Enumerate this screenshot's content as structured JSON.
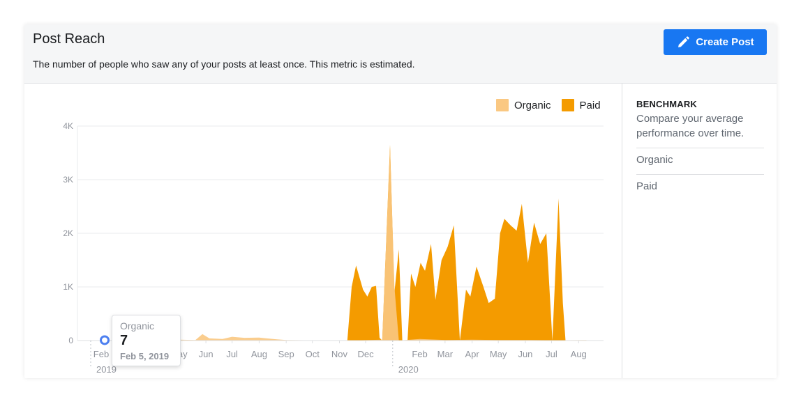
{
  "header": {
    "title": "Post Reach",
    "subtitle": "The number of people who saw any of your posts at least once. This metric is estimated.",
    "create_post_label": "Create Post"
  },
  "colors": {
    "organic": "#fac882",
    "paid": "#f49b00",
    "primary": "#1877f2",
    "highlight": "#4c7ff0"
  },
  "chart_data": {
    "type": "area",
    "title": "",
    "xlabel": "",
    "ylabel": "",
    "ylim": [
      0,
      4000
    ],
    "y_ticks": [
      {
        "value": 0,
        "label": "0"
      },
      {
        "value": 1000,
        "label": "1K"
      },
      {
        "value": 2000,
        "label": "2K"
      },
      {
        "value": 3000,
        "label": "3K"
      },
      {
        "value": 4000,
        "label": "4K"
      }
    ],
    "x_ticks": [
      "Feb",
      "May",
      "Jun",
      "Jul",
      "Aug",
      "Sep",
      "Oct",
      "Nov",
      "Dec",
      "Feb",
      "Mar",
      "Apr",
      "May",
      "Jun",
      "Jul",
      "Aug"
    ],
    "x_years": [
      "2019",
      "2020"
    ],
    "legend_position": "top-right",
    "grid": true,
    "series": [
      {
        "name": "Organic",
        "points": [
          [
            "2019-02-05",
            7
          ],
          [
            "2019-04-01",
            5
          ],
          [
            "2019-05-01",
            15
          ],
          [
            "2019-05-20",
            10
          ],
          [
            "2019-05-28",
            120
          ],
          [
            "2019-06-05",
            40
          ],
          [
            "2019-06-20",
            30
          ],
          [
            "2019-07-01",
            70
          ],
          [
            "2019-07-15",
            50
          ],
          [
            "2019-08-01",
            55
          ],
          [
            "2019-08-20",
            25
          ],
          [
            "2019-09-01",
            10
          ],
          [
            "2019-10-01",
            5
          ],
          [
            "2019-11-01",
            0
          ],
          [
            "2019-11-10",
            0
          ],
          [
            "2019-12-20",
            15
          ],
          [
            "2019-12-29",
            3600
          ],
          [
            "2020-01-03",
            1000
          ],
          [
            "2020-01-08",
            0
          ],
          [
            "2020-02-01",
            30
          ],
          [
            "2020-03-01",
            10
          ],
          [
            "2020-04-01",
            15
          ],
          [
            "2020-05-01",
            10
          ],
          [
            "2020-06-01",
            10
          ],
          [
            "2020-07-01",
            5
          ],
          [
            "2020-08-10",
            10
          ]
        ]
      },
      {
        "name": "Paid",
        "points": [
          [
            "2019-02-05",
            0
          ],
          [
            "2019-11-10",
            0
          ],
          [
            "2019-11-15",
            1000
          ],
          [
            "2019-11-20",
            1400
          ],
          [
            "2019-11-28",
            950
          ],
          [
            "2019-12-03",
            820
          ],
          [
            "2019-12-08",
            1000
          ],
          [
            "2019-12-13",
            1020
          ],
          [
            "2019-12-17",
            50
          ],
          [
            "2019-12-20",
            0
          ],
          [
            "2019-12-29",
            3650
          ],
          [
            "2020-01-03",
            900
          ],
          [
            "2020-01-08",
            1700
          ],
          [
            "2020-01-12",
            0
          ],
          [
            "2020-01-18",
            0
          ],
          [
            "2020-01-22",
            1250
          ],
          [
            "2020-01-27",
            1000
          ],
          [
            "2020-02-02",
            1450
          ],
          [
            "2020-02-07",
            1300
          ],
          [
            "2020-02-14",
            1800
          ],
          [
            "2020-02-19",
            760
          ],
          [
            "2020-02-26",
            1500
          ],
          [
            "2020-03-04",
            1750
          ],
          [
            "2020-03-11",
            2150
          ],
          [
            "2020-03-18",
            0
          ],
          [
            "2020-03-25",
            950
          ],
          [
            "2020-03-30",
            820
          ],
          [
            "2020-04-06",
            1380
          ],
          [
            "2020-04-14",
            1000
          ],
          [
            "2020-04-20",
            700
          ],
          [
            "2020-04-27",
            780
          ],
          [
            "2020-05-03",
            2000
          ],
          [
            "2020-05-08",
            2270
          ],
          [
            "2020-05-15",
            2150
          ],
          [
            "2020-05-22",
            2050
          ],
          [
            "2020-05-28",
            2550
          ],
          [
            "2020-06-04",
            1450
          ],
          [
            "2020-06-11",
            2200
          ],
          [
            "2020-06-18",
            1800
          ],
          [
            "2020-06-25",
            2000
          ],
          [
            "2020-07-02",
            0
          ],
          [
            "2020-07-09",
            2650
          ],
          [
            "2020-07-14",
            700
          ],
          [
            "2020-07-17",
            0
          ]
        ]
      }
    ],
    "highlight": {
      "series": "Organic",
      "value": 7,
      "date_label": "Feb 5, 2019"
    }
  },
  "benchmark": {
    "title": "BENCHMARK",
    "description": "Compare your average performance over time.",
    "rows": [
      "Organic",
      "Paid"
    ]
  },
  "tooltip": {
    "series": "Organic",
    "value": "7",
    "date": "Feb 5, 2019"
  }
}
